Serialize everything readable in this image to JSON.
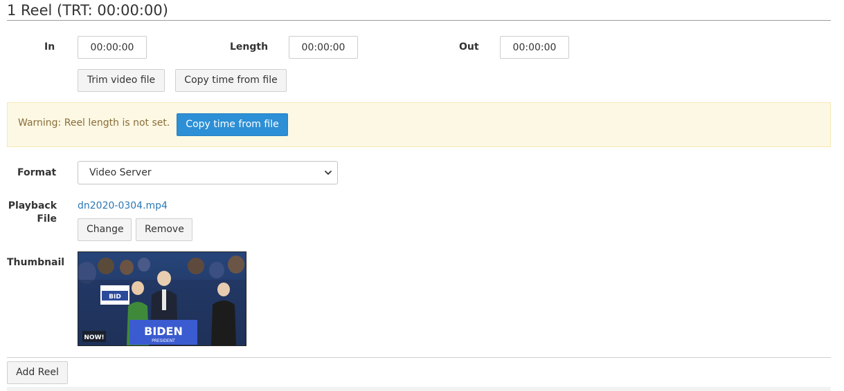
{
  "header": {
    "title": "1 Reel (TRT: 00:00:00)"
  },
  "timing": {
    "in_label": "In",
    "in_value": "00:00:00",
    "length_label": "Length",
    "length_value": "00:00:00",
    "out_label": "Out",
    "out_value": "00:00:00",
    "trim_button": "Trim video file",
    "copy_time_button": "Copy time from file"
  },
  "warning": {
    "text": "Warning: Reel length is not set.",
    "action_button": "Copy time from file"
  },
  "format": {
    "label": "Format",
    "selected": "Video Server"
  },
  "playback": {
    "label_line1": "Playback",
    "label_line2": "File",
    "file_name": "dn2020-0304.mp4",
    "change_button": "Change",
    "remove_button": "Remove"
  },
  "thumbnail": {
    "label": "Thumbnail"
  },
  "footer": {
    "add_reel_button": "Add Reel"
  },
  "colors": {
    "primary_button": "#2d8fd5",
    "warning_bg": "#fcf8e3",
    "warning_text": "#8a6d3b",
    "link": "#2a78b5"
  }
}
